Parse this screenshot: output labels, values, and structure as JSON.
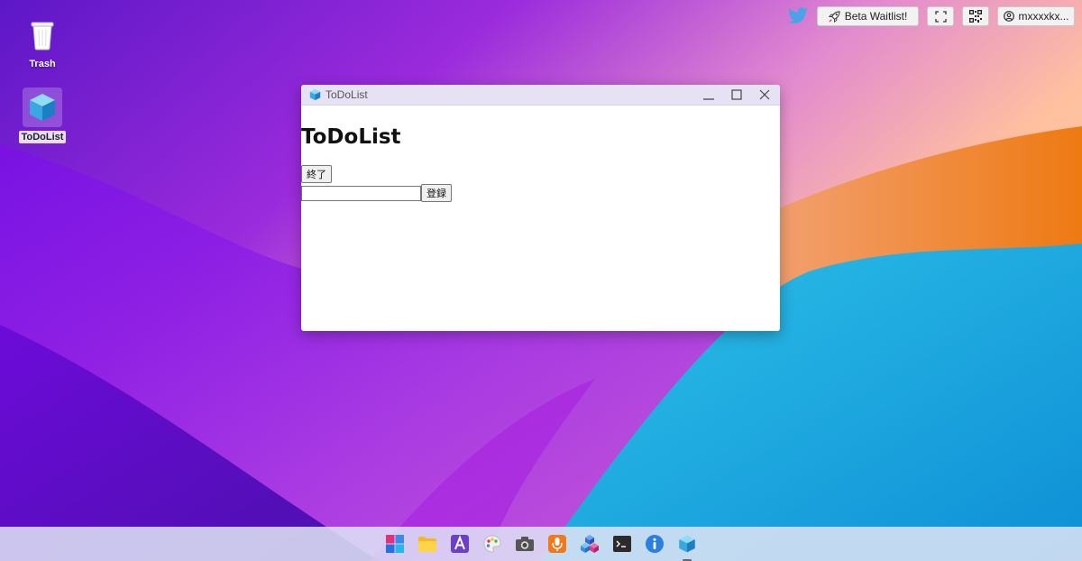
{
  "desktop": {
    "icons": [
      {
        "label": "Trash"
      },
      {
        "label": "ToDoList"
      }
    ]
  },
  "topbar": {
    "beta_label": "Beta Waitlist!",
    "user_label": "mxxxxkx..."
  },
  "window": {
    "title": "ToDoList",
    "heading": "ToDoList",
    "quit_label": "終了",
    "add_label": "登録",
    "input_value": "",
    "input_placeholder": ""
  },
  "taskbar": {
    "apps": [
      "start",
      "files",
      "fonts",
      "paint",
      "camera",
      "recorder",
      "boxes",
      "terminal",
      "info",
      "todolist"
    ]
  },
  "colors": {
    "twitter": "#1da1f2",
    "titlebar": "#e6e1f3",
    "accent": "#2a7fe0"
  }
}
